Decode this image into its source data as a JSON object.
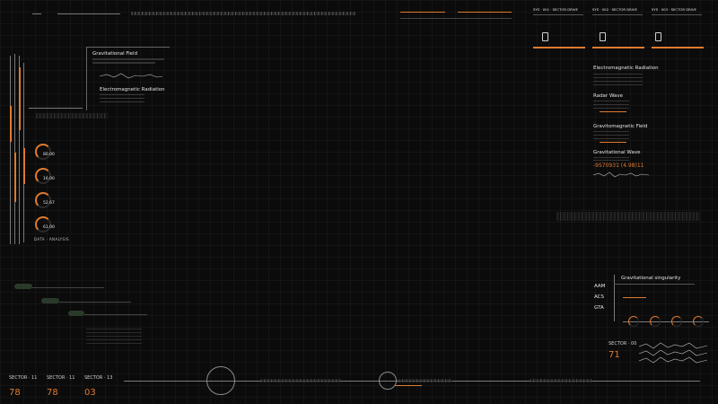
{
  "top_left_panel": {
    "label_gravitational_field": "Gravitational Field",
    "label_em_radiation": "Electromagnetic Radiation",
    "gauges": [
      "80.00",
      "16.00",
      "52.67",
      "61.00"
    ],
    "gauge_caption": "DATA · ANALYSIS"
  },
  "right_panel": {
    "sections": [
      "Electromagnetic Radiation",
      "Radar Wave",
      "Gravitomagnetic Field",
      "Gravitational Wave"
    ],
    "readout": "-9570931 (4.98)11"
  },
  "top_cards": [
    {
      "title": "SYS · 001 · SECTOR DRIVE"
    },
    {
      "title": "SYS · 002 · SECTOR DRIVE"
    },
    {
      "title": "SYS · 003 · SECTOR DRIVE"
    }
  ],
  "bottom_right_panel": {
    "title": "Gravitational singularity",
    "row_labels": [
      "AAM",
      "ACS",
      "GTA"
    ],
    "sector_label": "SECTOR · 00",
    "sector_value": "71"
  },
  "bottom_sectors": [
    {
      "label": "SECTOR · 11",
      "value": "78"
    },
    {
      "label": "SECTOR · 11",
      "value": "78"
    },
    {
      "label": "SECTOR · 13",
      "value": "03"
    }
  ],
  "colors": {
    "accent": "#e07a2e",
    "line": "#7a7a7a",
    "background": "#0b0b0b"
  }
}
